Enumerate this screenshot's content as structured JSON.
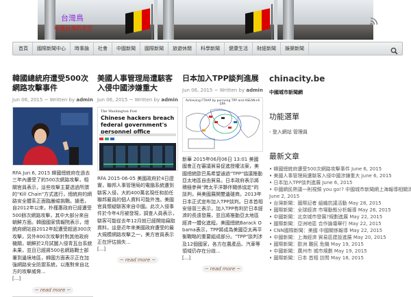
{
  "header": {
    "site_title": "台灣鳥",
    "tagline": "中國台灣的天空"
  },
  "nav": {
    "items": [
      "首頁",
      "國際新聞中心",
      "時事論",
      "社會",
      "中國新聞",
      "國際新聞",
      "旅遊休閒",
      "科學新聞",
      "健康生活",
      "財經新聞",
      "娛樂新聞"
    ]
  },
  "posts": [
    {
      "title": "韓國總統府遭受500次網路攻擊事件",
      "date": "Jun 06, 2015",
      "written_by": "~ Written by",
      "author": "admin",
      "excerpt": "RFA Jun 6, 2015 韓國總統府在過去三年內遭受了約500次網路攻擊，相關官員表示，這些攻擊主要透過所謂的\"Kill Chain\"方式進行，總統府的網路安全體系正面臨嚴峻挑戰。據悉，自2012年以來，朴槿惠政府已經遭受500餘次網路攻擊，其中大部分來自朝鮮方面。韓國國家情報院表示，總統府網站自2012年起遭受超過300次攻擊，另外800次攻擊針對其他政府機關，朝鮮於2月試圖入侵青瓦台系統未果，並且已經將500名網路戰士部署到邊境地區，韓國方面表示正在加強網路安全防禦系統，以應對來自北方的攻擊威脅...",
      "more": "[...]",
      "read_more": "~ read more ~"
    },
    {
      "title": "美國人事管理局遭駭客入侵中國涉嫌重大",
      "date": "Jun 06, 2015",
      "written_by": "~ Written by",
      "author": "admin",
      "img_masthead": "The Washington Post",
      "img_headline": "Chinese hackers breach federal government's personnel office",
      "excerpt": "RFA 2015-06-05 美國政府於4日證實，聯邦人事管理局的電腦系統遭到駭客入侵，大約400萬名現任和前任聯邦雇員的個人資料可能外洩。美國官員懷疑駭客來自中國。此次入侵事件於今年4月被發現，調查人員表示，駭客可能從去年12月就已經開始竊取資料，這是近年來美國政府遭受的最大規模網路攻擊之一，美方官員表示正在評估損失...",
      "more": "[...]",
      "read_more": "~ read more ~"
    },
    {
      "title": "日本加入TPP談判進展",
      "date": "Jun 06, 2015",
      "written_by": "~ Written by",
      "author": "admin",
      "img_caption": "Achieving FTAAP by pursuing TPP and ASEAN+6 EPA",
      "excerpt": "新華 2015年06月06日 13:01 美國國會正在審議貿易促進授權法案，美國總統歐巴馬希望通過\"TPP\"協議推動亞太地區自由貿易。日本政府表示將積極參與\"跨太平洋夥伴關係協定\"的談判，與美國展開雙邊磋商。2013年日本正式宣布加入TPP談判。日本首相安倍晉三表示，加入TPP有利於日本經濟的長遠發展，並且將推動亞太地區經濟一體化進程。美國總統Barack Obama表示，TPP將成為美國亞太再平衡戰略的重要組成部分。\"TPP\"談判涉及12個國家，各方在農產品、汽車等領域仍存在分歧...",
      "more": "[...]",
      "read_more": "~ read more ~"
    }
  ],
  "sidebar": {
    "title": "chinacity.be",
    "subtitle": "中國城市新聞網",
    "meta_heading": "功能選單",
    "meta_item": "- 登入網站 管理員",
    "recent_heading": "最新文章",
    "recent": [
      {
        "title": "韓國總統府遭受500次網路攻擊事件",
        "date": "June 6, 2015"
      },
      {
        "title": "美國人事管理局遭駭客入侵中國涉嫌重大",
        "date": "June 6, 2015"
      },
      {
        "title": "日本加入TPP談判進展",
        "date": "June 6, 2015"
      },
      {
        "title": "中國網民熱議一則視頻 you go!?",
        "date": "中國城市新聞網上海報導相關消息"
      },
      {
        "title": "June 2, 2015",
        "date": ""
      },
      {
        "title": "台灣新聞：國際記者 組織抗議活動",
        "date": "May 28, 2015"
      },
      {
        "title": "國際新聞：全球經濟 市場動態分析報導",
        "date": "May 26, 2015"
      },
      {
        "title": "中國新聞：北京城市發展?規劃進展",
        "date": "May 22, 2015"
      },
      {
        "title": "國際新聞：亞洲地區 合作論壇舉行",
        "date": "May 22, 2015"
      },
      {
        "title": "CNN國際新聞：美國 中國關係報導",
        "date": "May 22, 2015"
      },
      {
        "title": "中國新聞：上海經濟 貿易區建設進展",
        "date": "May 20, 2015"
      },
      {
        "title": "國際新聞：歐洲 難民 危機",
        "date": "May 19, 2015"
      },
      {
        "title": "中國新聞：廣州市 城市規劃",
        "date": "May 19, 2015"
      },
      {
        "title": "國際新聞：日本 首相 訪問",
        "date": "May 18, 2015"
      }
    ]
  },
  "colors": {
    "site_title": "#8a2be2",
    "tagline": "#dd1111",
    "read_more": "#8b5a3c"
  }
}
